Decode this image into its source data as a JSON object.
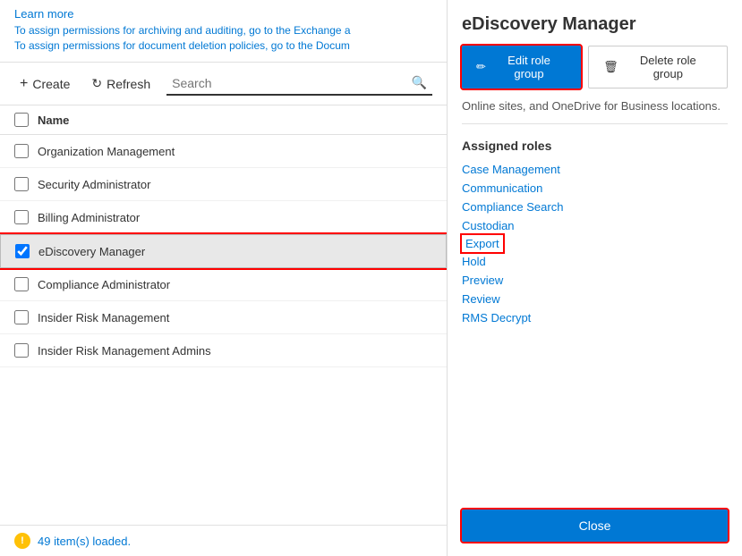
{
  "header": {
    "learn_more": "Learn more",
    "assign_archiving": "To assign permissions for archiving and auditing, go to the Exchange a",
    "assign_deletion": "To assign permissions for document deletion policies, go to the Docum"
  },
  "toolbar": {
    "create_label": "Create",
    "refresh_label": "Refresh",
    "search_placeholder": "Search"
  },
  "table": {
    "column_name": "Name",
    "rows": [
      {
        "name": "Organization Management",
        "checked": false,
        "selected": false
      },
      {
        "name": "Security Administrator",
        "checked": false,
        "selected": false
      },
      {
        "name": "Billing Administrator",
        "checked": false,
        "selected": false
      },
      {
        "name": "eDiscovery Manager",
        "checked": true,
        "selected": true
      },
      {
        "name": "Compliance Administrator",
        "checked": false,
        "selected": false
      },
      {
        "name": "Insider Risk Management",
        "checked": false,
        "selected": false
      },
      {
        "name": "Insider Risk Management Admins",
        "checked": false,
        "selected": false
      }
    ]
  },
  "status_bar": {
    "text": "49 item(s) loaded."
  },
  "right_panel": {
    "title": "eDiscovery Manager",
    "edit_label": "Edit role group",
    "delete_label": "Delete role group",
    "description": "Online sites, and OneDrive for Business locations.",
    "assigned_roles_title": "Assigned roles",
    "roles": [
      {
        "name": "Case Management",
        "highlighted": false
      },
      {
        "name": "Communication",
        "highlighted": false
      },
      {
        "name": "Compliance Search",
        "highlighted": false
      },
      {
        "name": "Custodian",
        "highlighted": false
      },
      {
        "name": "Export",
        "highlighted": true
      },
      {
        "name": "Hold",
        "highlighted": false
      },
      {
        "name": "Preview",
        "highlighted": false
      },
      {
        "name": "Review",
        "highlighted": false
      },
      {
        "name": "RMS Decrypt",
        "highlighted": false
      }
    ],
    "close_label": "Close"
  }
}
